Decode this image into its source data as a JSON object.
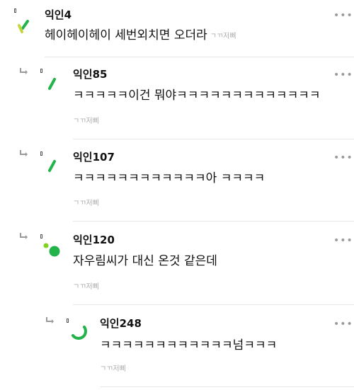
{
  "more_label": "•••",
  "comments": [
    {
      "author": "익인4",
      "text": "헤이헤이헤이 세번외치면 오더라",
      "meta": "ㄱㄲ저삐"
    },
    {
      "author": "익인85",
      "text": "ㅋㅋㅋㅋㅋ이건 뭐야ㅋㅋㅋㅋㅋㅋㅋㅋㅋㅋㅋㅋㅋ",
      "meta": "ㄱㄲ저삐"
    },
    {
      "author": "익인107",
      "text": "ㅋㅋㅋㅋㅋㅋㅋㅋㅋㅋㅋㅋ아 ㅋㅋㅋㅋ",
      "meta": "ㄱㄲ저삐"
    },
    {
      "author": "익인120",
      "text": "자우림씨가 대신 온것 같은데",
      "meta": "ㄱㄲ저삐"
    },
    {
      "author": "익인248",
      "text": "ㅋㅋㅋㅋㅋㅋㅋㅋㅋㅋㅋㅋ넘ㅋㅋㅋ",
      "meta": "ㄱㄲ저삐"
    }
  ],
  "icons": {
    "reply": "reply-arrow-icon",
    "more": "more-options-icon",
    "badge": "badge-icon"
  },
  "colors": {
    "avatar_green": "#22b34a",
    "avatar_yellow": "#c6d63a",
    "avatar_lime": "#7ed321"
  }
}
